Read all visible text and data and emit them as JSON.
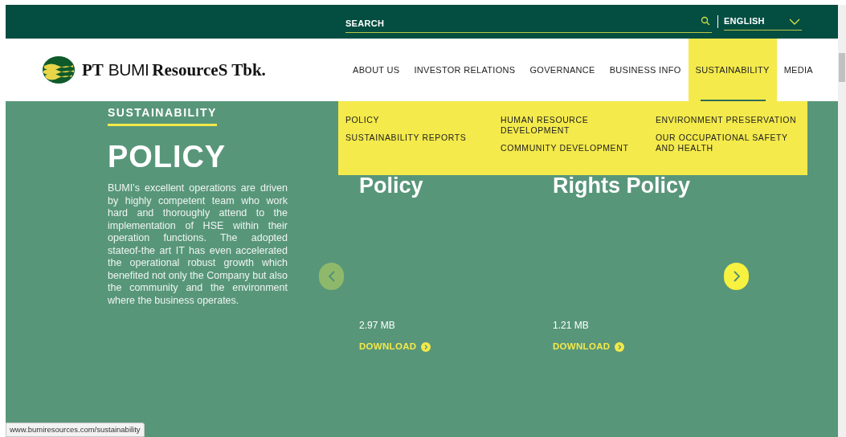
{
  "top_bar": {
    "search": {
      "placeholder": "SEARCH"
    },
    "language": {
      "value": "ENGLISH"
    }
  },
  "header": {
    "logo": [
      "PT",
      "BUMI",
      "ResourceS Tbk."
    ],
    "nav": [
      {
        "label": "ABOUT US",
        "selected": false
      },
      {
        "label": "INVESTOR RELATIONS",
        "selected": false
      },
      {
        "label": "GOVERNANCE",
        "selected": false
      },
      {
        "label": "BUSINESS INFO",
        "selected": false
      },
      {
        "label": "SUSTAINABILITY",
        "selected": true
      },
      {
        "label": "MEDIA",
        "selected": false
      }
    ]
  },
  "dropdown": {
    "columns": [
      [
        "POLICY",
        "SUSTAINABILITY REPORTS"
      ],
      [
        "HUMAN RESOURCE DEVELOPMENT",
        "COMMUNITY DEVELOPMENT"
      ],
      [
        "ENVIRONMENT PRESERVATION",
        "OUR OCCUPATIONAL SAFETY AND HEALTH"
      ]
    ]
  },
  "hero": {
    "eyebrow": "SUSTAINABILITY",
    "title": "POLICY",
    "body": "BUMI's excellent operations are driven by highly competent team who work hard and thoroughly attend to the implementation of HSE within their operation functions. The adopted stateof-the art IT has even accelerated the operational robust growth which benefited not only the Company but also the community and the environment where the business operates."
  },
  "carousel": {
    "prev": {
      "disabled": true
    },
    "next": {
      "disabled": false
    },
    "documents": [
      {
        "title": "Policy",
        "size": "2.97 MB",
        "action": "DOWNLOAD"
      },
      {
        "title": "Rights Policy",
        "size": "1.21 MB",
        "action": "DOWNLOAD"
      }
    ]
  },
  "status_bar": {
    "url": "www.bumiresources.com/sustainability"
  }
}
